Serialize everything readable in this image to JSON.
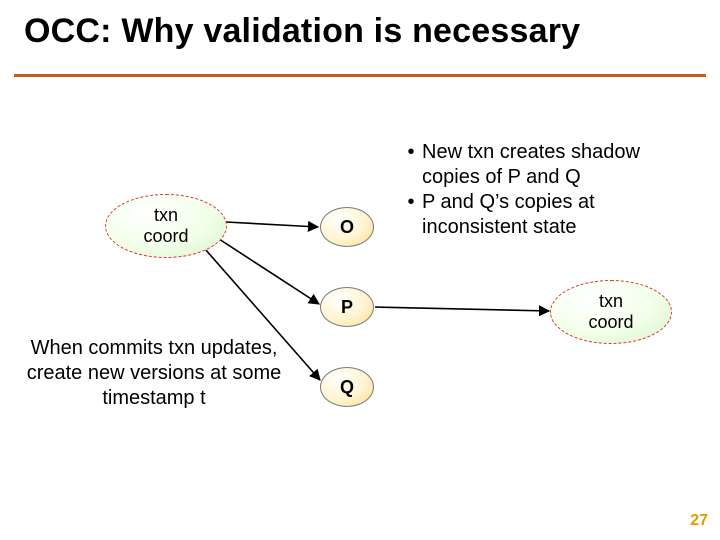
{
  "title": "OCC:  Why validation is necessary",
  "rule_color": "#c85a19",
  "coord_left": {
    "line1": "txn",
    "line2": "coord"
  },
  "coord_right": {
    "line1": "txn",
    "line2": "coord"
  },
  "nodes": {
    "o": "O",
    "p": "P",
    "q": "Q"
  },
  "bullets": [
    "New txn creates shadow copies of P and Q",
    "P and Q’s copies at inconsistent state"
  ],
  "commit_text": "When commits txn updates, create new versions at some timestamp t",
  "page_number": "27"
}
